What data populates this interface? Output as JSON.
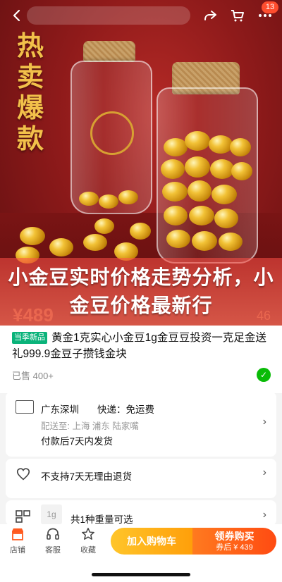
{
  "hero": {
    "side_text": "热卖爆款",
    "overlay_title": "小金豆实时价格走势分析，小金豆价格最新行",
    "ghost_price": "¥489",
    "ghost_right": "46"
  },
  "topbar": {
    "back_icon": "chevron-left-icon",
    "share_icon": "share-icon",
    "cart_icon": "cart-icon",
    "more_icon": "more-icon",
    "more_badge": "13"
  },
  "product": {
    "tag": "当季新品",
    "title": "黄金1克实心小金豆1g金豆豆投资一克足金送礼999.9金豆子攒钱金块",
    "sold": "已售 400+"
  },
  "shipping": {
    "from": "广东深圳",
    "express": "快递：免运费",
    "deliver_to": "配送至: 上海 浦东 陆家嘴",
    "dispatch": "付款后7天内发货"
  },
  "return_policy": {
    "text": "不支持7天无理由退货"
  },
  "spec": {
    "thumb_text": "1g",
    "text": "共1种重量可选"
  },
  "bottom_nav": {
    "store": "店铺",
    "service": "客服",
    "favorite": "收藏",
    "add_cart": "加入购物车",
    "buy_title": "领券购买",
    "buy_sub": "券后 ¥ 439"
  },
  "colors": {
    "accent": "#ff4b12",
    "gold": "#f2c04a",
    "green": "#0ab37a"
  }
}
